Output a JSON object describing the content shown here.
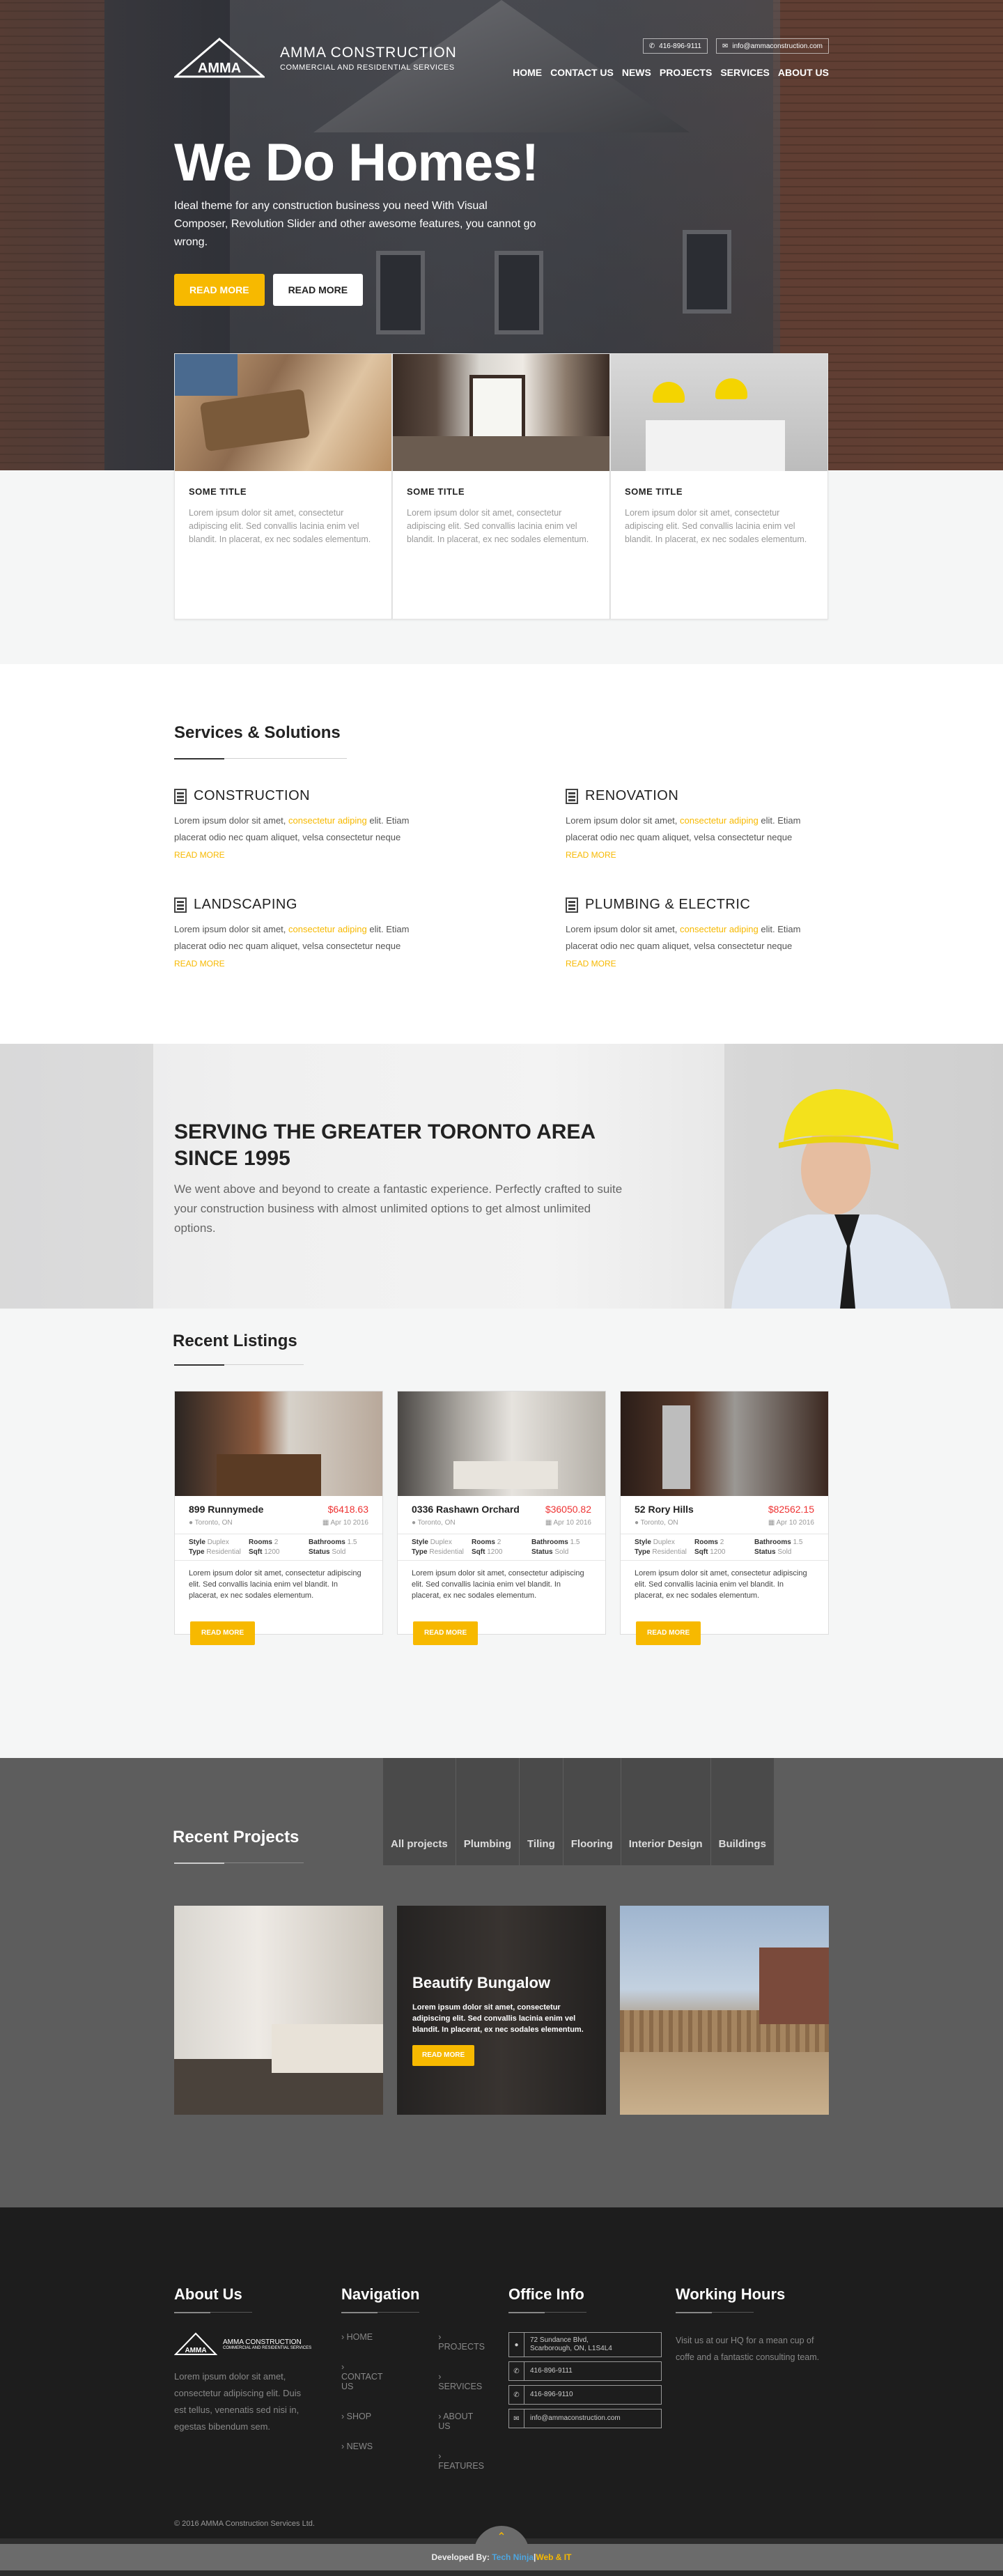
{
  "brand": {
    "name": "AMMA CONSTRUCTION",
    "tagline": "COMMERCIAL AND RESIDENTIAL SERVICES",
    "mark": "AMMA"
  },
  "topbar": {
    "phone": "416-896-9111",
    "email": "info@ammaconstruction.com"
  },
  "nav": [
    "HOME",
    "CONTACT US",
    "NEWS",
    "PROJECTS",
    "SERVICES",
    "ABOUT US"
  ],
  "hero": {
    "title": "We Do Homes!",
    "text": "Ideal theme for any construction business you need With Visual Composer, Revolution Slider and other awesome features, you cannot go wrong.",
    "btn_primary": "READ MORE",
    "btn_secondary": "READ MORE"
  },
  "features": [
    {
      "title": "SOME TITLE",
      "text": "Lorem ipsum dolor sit amet, consectetur adipiscing elit. Sed convallis lacinia enim vel blandit. In placerat, ex nec sodales elementum."
    },
    {
      "title": "SOME TITLE",
      "text": "Lorem ipsum dolor sit amet, consectetur adipiscing elit. Sed convallis lacinia enim vel blandit. In placerat, ex nec sodales elementum."
    },
    {
      "title": "SOME TITLE",
      "text": "Lorem ipsum dolor sit amet, consectetur adipiscing elit. Sed convallis lacinia enim vel blandit. In placerat, ex nec sodales elementum."
    }
  ],
  "services": {
    "title": "Services & Solutions",
    "items": [
      {
        "name": "CONSTRUCTION",
        "pre": "Lorem ipsum dolor sit amet, ",
        "hl": "consectetur adiping",
        "post": " elit. Etiam placerat odio nec quam aliquet, velsa consectetur neque",
        "more": "READ MORE"
      },
      {
        "name": "RENOVATION",
        "pre": "Lorem ipsum dolor sit amet, ",
        "hl": "consectetur adiping",
        "post": " elit. Etiam placerat odio nec quam aliquet, velsa consectetur neque",
        "more": "READ MORE"
      },
      {
        "name": "LANDSCAPING",
        "pre": "Lorem ipsum dolor sit amet, ",
        "hl": "consectetur adiping",
        "post": " elit. Etiam placerat odio nec quam aliquet, velsa consectetur neque",
        "more": "READ MORE"
      },
      {
        "name": "PLUMBING & ELECTRIC",
        "pre": "Lorem ipsum dolor sit amet, ",
        "hl": "consectetur adiping",
        "post": " elit. Etiam placerat odio nec quam aliquet, velsa consectetur neque",
        "more": "READ MORE"
      }
    ]
  },
  "serving": {
    "title": "SERVING THE GREATER TORONTO AREA SINCE 1995",
    "text": "We went above and beyond to create a fantastic experience. Perfectly crafted to suite your construction business with almost unlimited options to get almost unlimited options."
  },
  "listings": {
    "title": "Recent Listings",
    "items": [
      {
        "name": "899 Runnymede",
        "price": "$6418.63",
        "city": "Toronto, ON",
        "date": "Apr 10 2016",
        "style_l": "Style",
        "style": "Duplex",
        "rooms_l": "Rooms",
        "rooms": "2",
        "bath_l": "Bathrooms",
        "bath": "1.5",
        "type_l": "Type",
        "type": "Residential",
        "sqft_l": "Sqft",
        "sqft": "1200",
        "status_l": "Status",
        "status": "Sold",
        "desc": "Lorem ipsum dolor sit amet, consectetur adipiscing elit. Sed convallis lacinia enim vel blandit. In placerat, ex nec sodales elementum.",
        "more": "READ MORE"
      },
      {
        "name": "0336 Rashawn Orchard",
        "price": "$36050.82",
        "city": "Toronto, ON",
        "date": "Apr 10 2016",
        "style_l": "Style",
        "style": "Duplex",
        "rooms_l": "Rooms",
        "rooms": "2",
        "bath_l": "Bathrooms",
        "bath": "1.5",
        "type_l": "Type",
        "type": "Residential",
        "sqft_l": "Sqft",
        "sqft": "1200",
        "status_l": "Status",
        "status": "Sold",
        "desc": "Lorem ipsum dolor sit amet, consectetur adipiscing elit. Sed convallis lacinia enim vel blandit. In placerat, ex nec sodales elementum.",
        "more": "READ MORE"
      },
      {
        "name": "52 Rory Hills",
        "price": "$82562.15",
        "city": "Toronto, ON",
        "date": "Apr 10 2016",
        "style_l": "Style",
        "style": "Duplex",
        "rooms_l": "Rooms",
        "rooms": "2",
        "bath_l": "Bathrooms",
        "bath": "1.5",
        "type_l": "Type",
        "type": "Residential",
        "sqft_l": "Sqft",
        "sqft": "1200",
        "status_l": "Status",
        "status": "Sold",
        "desc": "Lorem ipsum dolor sit amet, consectetur adipiscing elit. Sed convallis lacinia enim vel blandit. In placerat, ex nec sodales elementum.",
        "more": "READ MORE"
      }
    ]
  },
  "projects": {
    "title": "Recent Projects",
    "tabs": [
      "All projects",
      "Plumbing",
      "Tiling",
      "Flooring",
      "Interior Design",
      "Buildings"
    ],
    "featured": {
      "title": "Beautify Bungalow",
      "text": "Lorem ipsum dolor sit amet, consectetur adipiscing elit. Sed convallis lacinia enim vel blandit. In placerat, ex nec sodales elementum.",
      "btn": "READ MORE"
    }
  },
  "footer": {
    "about": {
      "title": "About Us",
      "text": "Lorem ipsum dolor sit amet, consectetur adipiscing elit. Duis est tellus, venenatis sed nisi in, egestas bibendum sem."
    },
    "nav": {
      "title": "Navigation",
      "col1": [
        "HOME",
        "CONTACT US",
        "SHOP",
        "NEWS"
      ],
      "col2": [
        "PROJECTS",
        "SERVICES",
        "ABOUT US",
        "FEATURES"
      ]
    },
    "office": {
      "title": "Office Info",
      "address1": "72 Sundance Blvd,",
      "address2": "Scarborough, ON, L1S4L4",
      "phone1": "416-896-9111",
      "phone2": "416-896-9110",
      "email": "info@ammaconstruction.com"
    },
    "hours": {
      "title": "Working Hours",
      "text": "Visit us at our HQ for a mean cup of coffe and a fantastic consulting team."
    },
    "copyright": "© 2016 AMMA Construction Services Ltd.",
    "dev_label": "Developed By:",
    "dev_name1": "Tech Ninja",
    "dev_sep": " | ",
    "dev_name2": "Web & IT"
  },
  "colors": {
    "accent": "#f7b900",
    "price": "#ee3333",
    "footer_bg": "#1d1d1d",
    "projects_bg": "#5d5d5d"
  }
}
